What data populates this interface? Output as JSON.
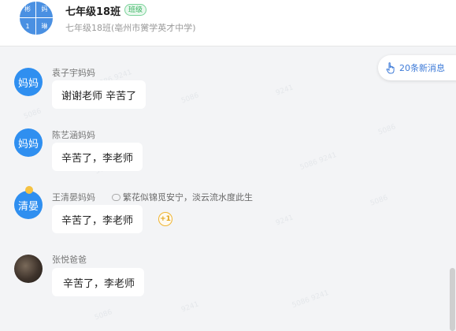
{
  "header": {
    "avatar_chars": [
      "彬",
      "妈",
      "1",
      "琳"
    ],
    "title": "七年级18班",
    "badge": "班级",
    "subtitle": "七年级18班(亳州市黉学英才中学)"
  },
  "new_messages": {
    "label": "20条新消息",
    "icon": "hand-pointer-icon"
  },
  "messages": [
    {
      "sender": "袁子宇妈妈",
      "avatar_text": "妈妈",
      "text": "谢谢老师  辛苦了"
    },
    {
      "sender": "陈艺涵妈妈",
      "avatar_text": "妈妈",
      "text": "辛苦了，李老师"
    },
    {
      "sender": "王清晏妈妈",
      "avatar_text": "清晏",
      "signature": "繁花似锦觅安宁，淡云流水度此生",
      "text": "辛苦了，李老师",
      "plus_one": "+1"
    },
    {
      "sender": "张悦爸爸",
      "avatar_text": "",
      "text": " 辛苦了，李老师"
    }
  ],
  "colors": {
    "accent": "#3e7bd8",
    "avatar_blue": "#2f8ff0",
    "background": "#f3f4f6",
    "badge_green": "#36b25f"
  }
}
